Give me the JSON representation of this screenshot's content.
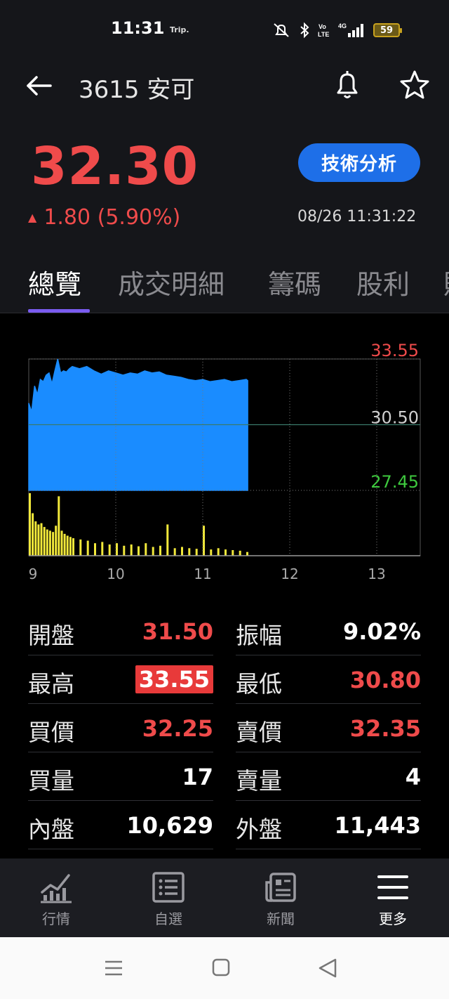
{
  "status_bar": {
    "time": "11:31",
    "carrier_tag": "Trip.",
    "battery": "59",
    "icons": [
      "mute-icon",
      "bluetooth-icon",
      "volte-icon",
      "4g-signal-icon"
    ]
  },
  "header": {
    "title": "3615 安可",
    "back_icon": "arrow-left-icon",
    "bell_icon": "bell-icon",
    "star_icon": "star-icon"
  },
  "quote": {
    "price": "32.30",
    "change": "1.80 (5.90%)",
    "change_direction": "up",
    "change_arrow": "▲",
    "timestamp": "08/26 11:31:22",
    "tech_button": "技術分析",
    "color_up": "#ef4b4b",
    "color_down": "#3ec83e"
  },
  "tabs": [
    {
      "label": "總覽",
      "active": true
    },
    {
      "label": "成交明細",
      "active": false
    },
    {
      "label": "籌碼",
      "active": false
    },
    {
      "label": "股利",
      "active": false
    },
    {
      "label": "財",
      "active": false
    }
  ],
  "chart_data": {
    "type": "area",
    "subtype": "intraday price with volume",
    "y_labels": {
      "high": "33.55",
      "ref": "30.50",
      "low": "27.45"
    },
    "ylim": [
      27.45,
      33.55
    ],
    "reference_price": 30.5,
    "x_ticks": [
      "9",
      "10",
      "11",
      "12",
      "13"
    ],
    "xlim_minutes": [
      0,
      270
    ],
    "price_series": {
      "x": [
        0,
        2,
        4,
        6,
        8,
        10,
        12,
        14,
        16,
        18,
        20,
        22,
        24,
        26,
        28,
        30,
        35,
        40,
        45,
        50,
        55,
        60,
        65,
        70,
        75,
        80,
        85,
        90,
        95,
        100,
        105,
        110,
        115,
        120,
        125,
        130,
        135,
        140,
        145,
        150,
        151
      ],
      "y": [
        31.5,
        31.1,
        32.3,
        31.9,
        32.6,
        32.5,
        32.8,
        32.9,
        32.4,
        33.0,
        33.55,
        32.9,
        33.0,
        32.95,
        33.1,
        33.2,
        33.1,
        33.2,
        33.0,
        32.85,
        33.0,
        32.9,
        32.8,
        32.9,
        32.85,
        33.0,
        32.9,
        32.95,
        32.8,
        32.75,
        32.7,
        32.6,
        32.55,
        32.6,
        32.5,
        32.55,
        32.6,
        32.5,
        32.55,
        32.6,
        32.55
      ],
      "color": "#1a8cff"
    },
    "volume_series": {
      "x": [
        0,
        2,
        4,
        6,
        8,
        10,
        12,
        14,
        16,
        18,
        20,
        22,
        24,
        26,
        28,
        30,
        35,
        40,
        45,
        50,
        55,
        60,
        65,
        70,
        75,
        80,
        85,
        90,
        95,
        100,
        105,
        110,
        115,
        120,
        125,
        130,
        135,
        140,
        145,
        150
      ],
      "values": [
        100,
        68,
        55,
        50,
        52,
        46,
        42,
        40,
        38,
        48,
        95,
        40,
        35,
        32,
        30,
        28,
        26,
        24,
        20,
        22,
        18,
        20,
        16,
        18,
        15,
        20,
        14,
        16,
        50,
        12,
        14,
        12,
        11,
        48,
        10,
        12,
        10,
        9,
        8,
        6
      ],
      "color": "#f2e93a"
    },
    "grid": true
  },
  "stats": [
    {
      "left": {
        "label": "開盤",
        "value": "31.50",
        "style": "red"
      },
      "right": {
        "label": "振幅",
        "value": "9.02%",
        "style": "white"
      }
    },
    {
      "left": {
        "label": "最高",
        "value": "33.55",
        "style": "highlight"
      },
      "right": {
        "label": "最低",
        "value": "30.80",
        "style": "red"
      }
    },
    {
      "left": {
        "label": "買價",
        "value": "32.25",
        "style": "red"
      },
      "right": {
        "label": "賣價",
        "value": "32.35",
        "style": "red"
      }
    },
    {
      "left": {
        "label": "買量",
        "value": "17",
        "style": "white"
      },
      "right": {
        "label": "賣量",
        "value": "4",
        "style": "white"
      }
    },
    {
      "left": {
        "label": "內盤",
        "value": "10,629",
        "style": "white"
      },
      "right": {
        "label": "外盤",
        "value": "11,443",
        "style": "white"
      }
    }
  ],
  "bottom_nav": [
    {
      "label": "行情",
      "icon": "chart-icon",
      "active": false
    },
    {
      "label": "自選",
      "icon": "list-icon",
      "active": false
    },
    {
      "label": "新聞",
      "icon": "news-icon",
      "active": false
    },
    {
      "label": "更多",
      "icon": "menu-icon",
      "active": true
    }
  ],
  "android_nav": [
    "recents-icon",
    "home-icon",
    "back-icon"
  ]
}
